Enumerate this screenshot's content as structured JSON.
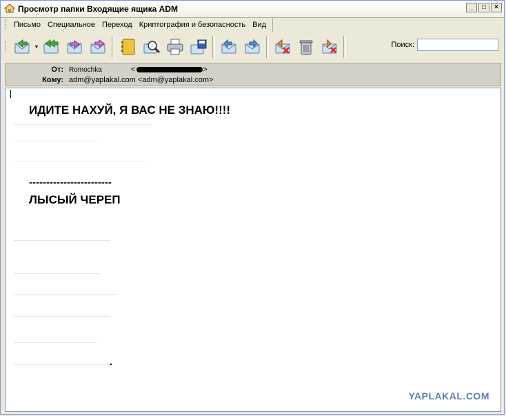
{
  "window": {
    "title": "Просмотр папки Входящие ящика ADM",
    "minimize": "_",
    "maximize": "□",
    "close": "×"
  },
  "menu": {
    "items": [
      "Письмо",
      "Специальное",
      "Переход",
      "Криптография и безопасность",
      "Вид"
    ]
  },
  "toolbar": {
    "buttons": [
      "reply-icon",
      "reply-all-icon",
      "forward-icon",
      "redirect-icon",
      "address-book-icon",
      "find-icon",
      "print-icon",
      "save-icon",
      "previous-message-icon",
      "next-message-icon",
      "delete-icon",
      "trash-icon",
      "junk-icon"
    ]
  },
  "search": {
    "label": "Поиск:",
    "value": ""
  },
  "headers": {
    "from_label": "От:",
    "from_name": "Romochka",
    "from_bracket": "<",
    "from_bracket_close": ">",
    "to_label": "Кому:",
    "to_value": "adm@yaplakal.com <adm@yaplakal.com>"
  },
  "message": {
    "line1": "ИДИТЕ НАХУЙ, Я ВАС НЕ ЗНАЮ!!!!",
    "separator": "------------------------",
    "signature": "ЛЫСЫЙ ЧЕРЕП"
  },
  "watermark": "YAPLAKAL.COM"
}
